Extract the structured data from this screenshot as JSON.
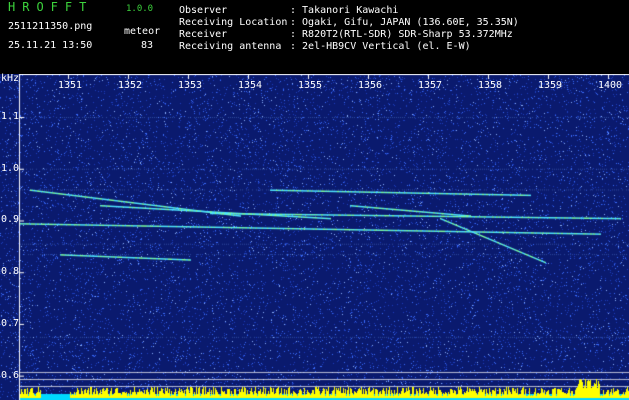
{
  "header": {
    "app_title": "HROFFT",
    "version": "1.0.0",
    "file_name": "2511211350.png",
    "datetime": "25.11.21 13:50",
    "meteor_label": "meteor",
    "meteor_count": "83"
  },
  "station": [
    {
      "label": "Observer",
      "value": ": Takanori Kawachi"
    },
    {
      "label": "Receiving Location",
      "value": ": Ogaki, Gifu, JAPAN (136.60E, 35.35N)"
    },
    {
      "label": "Receiver",
      "value": ": R820T2(RTL-SDR) SDR-Sharp 53.372MHz"
    },
    {
      "label": "Receiving antenna",
      "value": ": 2el-HB9CV Vertical (el. E-W)"
    }
  ],
  "spectrogram": {
    "unit": "kHz",
    "time_ticks": [
      "1351",
      "1352",
      "1353",
      "1354",
      "1355",
      "1356",
      "1357",
      "1358",
      "1359",
      "1400"
    ],
    "freq_ticks": [
      "1.1",
      "1.0",
      "0.9",
      "0.8",
      "0.7",
      "0.6"
    ],
    "freq_values": [
      1.1,
      1.0,
      0.9,
      0.8,
      0.7,
      0.6
    ],
    "freq_range_khz": [
      0.58,
      1.16
    ],
    "time_range_min": [
      0,
      10
    ],
    "colors": {
      "background": "#0a1a6e",
      "noise": "#3a6cff",
      "trace": "#7dffa0",
      "bottom_bar": "#ffff00",
      "base_strip": "#00d8ff"
    }
  }
}
